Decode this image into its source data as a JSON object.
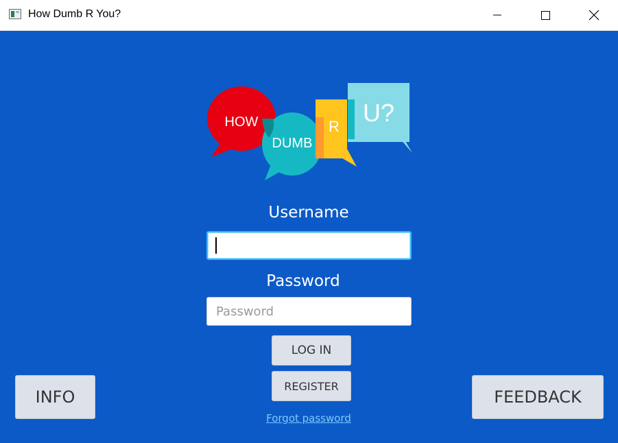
{
  "window": {
    "title": "How Dumb R You?",
    "controls": [
      "minimize",
      "maximize",
      "close"
    ]
  },
  "logo": {
    "bubbles": [
      "HOW",
      "DUMB",
      "R",
      "U?"
    ]
  },
  "login_form": {
    "username_label": "Username",
    "username_value": "",
    "password_label": "Password",
    "password_placeholder": "Password",
    "login_button": "LOG IN",
    "register_button": "REGISTER",
    "forgot_link": "Forgot password"
  },
  "footer": {
    "info_button": "INFO",
    "feedback_button": "FEEDBACK"
  },
  "colors": {
    "background": "#0c5ac7",
    "button": "#dde2ea",
    "link": "#7cc8ff",
    "focus_border": "#36b8ff"
  }
}
